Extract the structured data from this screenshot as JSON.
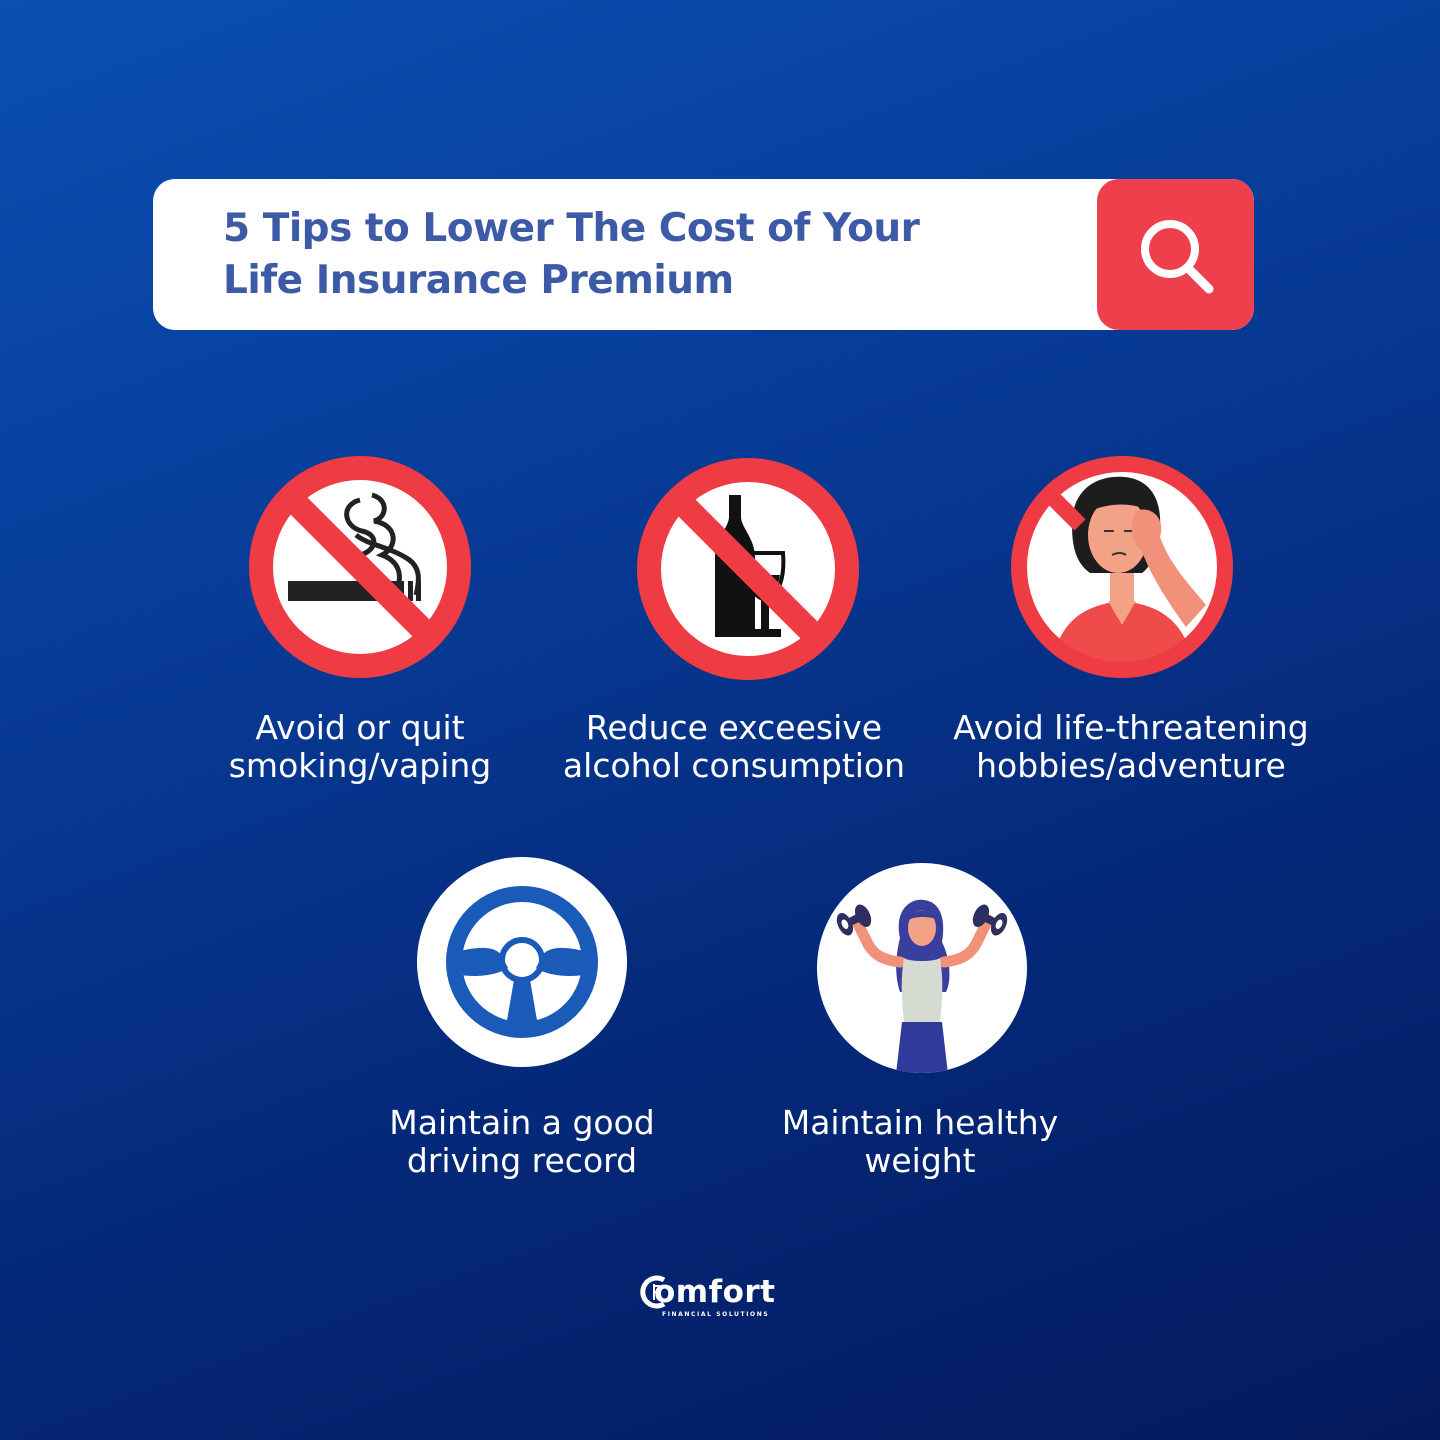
{
  "header": {
    "title_line1": "5 Tips to Lower The Cost of Your",
    "title_line2": "Life Insurance Premium"
  },
  "tips": [
    {
      "line1": "Avoid or quit",
      "line2": "smoking/vaping",
      "icon": "no-smoking-icon"
    },
    {
      "line1": "Reduce exceesive",
      "line2": "alcohol consumption",
      "icon": "no-alcohol-icon"
    },
    {
      "line1": "Avoid life-threatening",
      "line2": "hobbies/adventure",
      "icon": "no-risk-woman-icon"
    },
    {
      "line1": "Maintain a good",
      "line2": "driving record",
      "icon": "steering-wheel-icon"
    },
    {
      "line1": "Maintain healthy",
      "line2": "weight",
      "icon": "dumbbell-woman-icon"
    }
  ],
  "logo": {
    "name": "omfort",
    "tagline": "FINANCIAL SOLUTIONS"
  },
  "colors": {
    "accent_red": "#ee3f4d",
    "title_blue": "#3c5aa6",
    "wheel_blue": "#1a5ab8"
  }
}
